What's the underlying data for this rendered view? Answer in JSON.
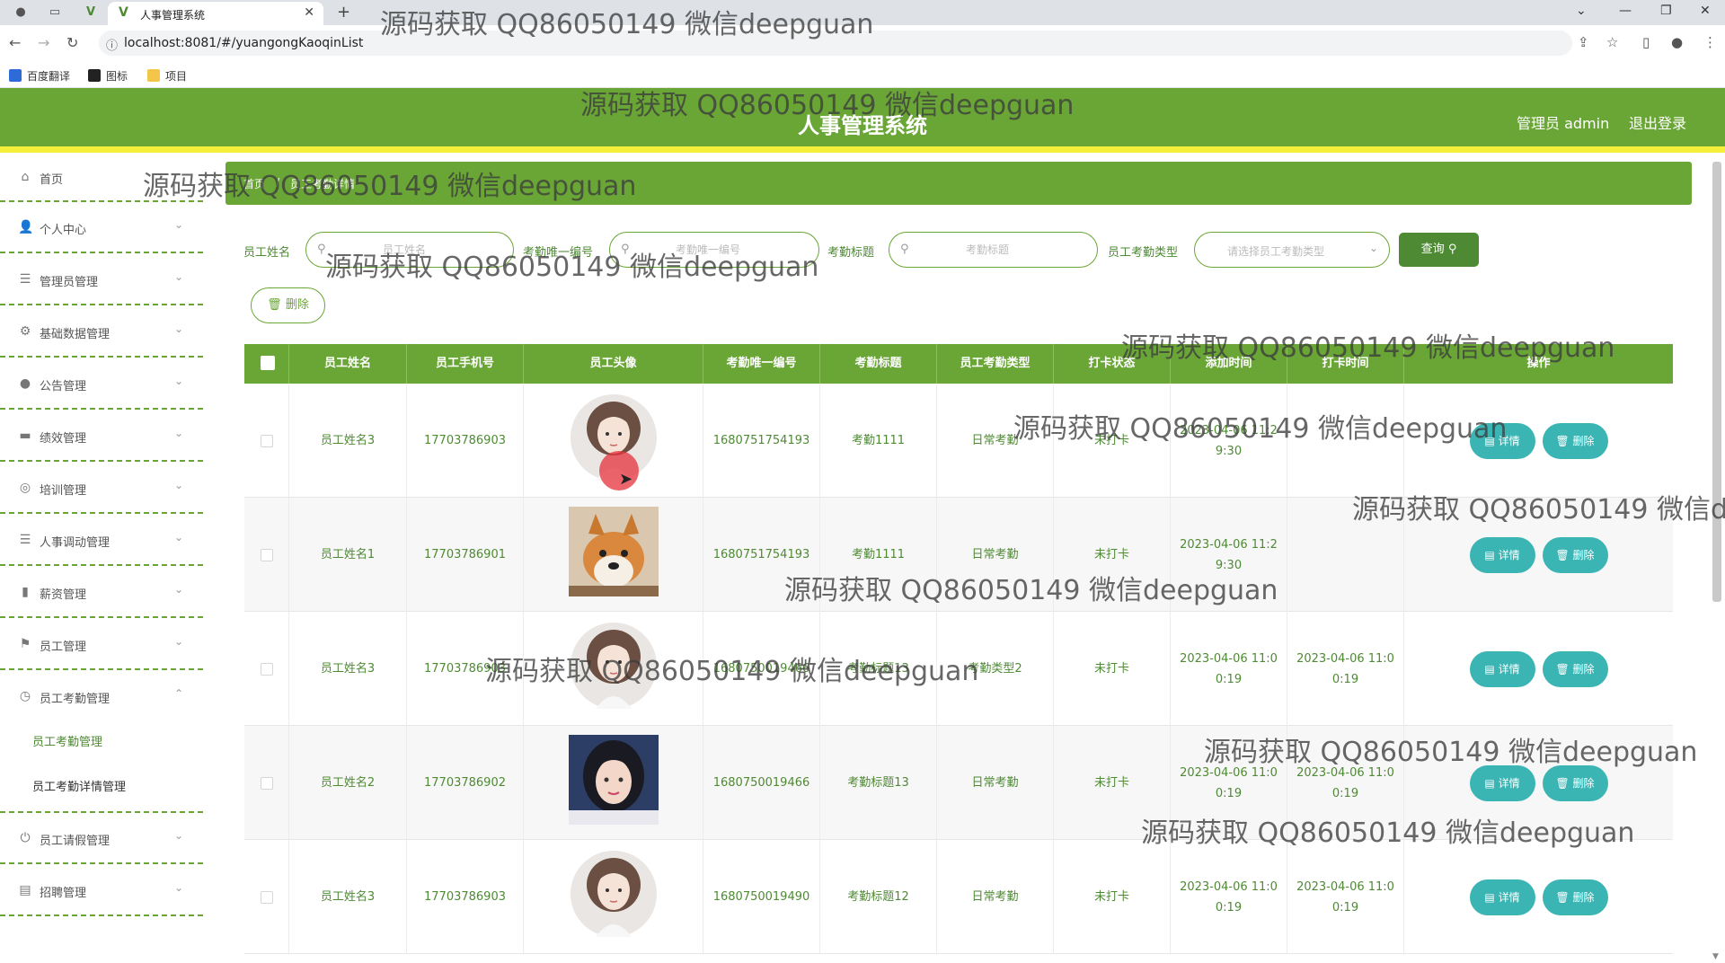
{
  "browser": {
    "tab_title": "人事管理系统",
    "url": "localhost:8081/#/yuangongKaoqinList",
    "bookmarks": [
      "百度翻译",
      "图标",
      "项目"
    ]
  },
  "header": {
    "title": "人事管理系统",
    "user": "管理员 admin",
    "logout": "退出登录"
  },
  "sidebar": {
    "items": [
      {
        "label": "首页",
        "icon": "home-icon"
      },
      {
        "label": "个人中心",
        "icon": "user-icon"
      },
      {
        "label": "管理员管理",
        "icon": "list-icon"
      },
      {
        "label": "基础数据管理",
        "icon": "settings-icon"
      },
      {
        "label": "公告管理",
        "icon": "pin-icon"
      },
      {
        "label": "绩效管理",
        "icon": "chat-icon"
      },
      {
        "label": "培训管理",
        "icon": "compass-icon"
      },
      {
        "label": "人事调动管理",
        "icon": "list-icon"
      },
      {
        "label": "薪资管理",
        "icon": "chart-icon"
      },
      {
        "label": "员工管理",
        "icon": "flag-icon"
      },
      {
        "label": "员工考勤管理",
        "icon": "clock-icon"
      },
      {
        "label": "员工请假管理",
        "icon": "power-icon"
      },
      {
        "label": "招聘管理",
        "icon": "card-icon"
      }
    ],
    "subitems": [
      "员工考勤管理",
      "员工考勤详情管理"
    ]
  },
  "breadcrumb": {
    "home": "首页",
    "current": "员工考勤详情"
  },
  "search": {
    "name_label": "员工姓名",
    "name_placeholder": "员工姓名",
    "code_label": "考勤唯一编号",
    "code_placeholder": "考勤唯一编号",
    "title_label": "考勤标题",
    "title_placeholder": "考勤标题",
    "type_label": "员工考勤类型",
    "type_placeholder": "请选择员工考勤类型",
    "query_button": "查询",
    "delete_button": "删除"
  },
  "table": {
    "headers": [
      "员工姓名",
      "员工手机号",
      "员工头像",
      "考勤唯一编号",
      "考勤标题",
      "员工考勤类型",
      "打卡状态",
      "添加时间",
      "打卡时间",
      "操作"
    ],
    "detail_label": "详情",
    "delete_label": "删除",
    "rows": [
      {
        "name": "员工姓名3",
        "phone": "17703786903",
        "avatar": "anime-girl",
        "code": "1680751754193",
        "title": "考勤1111",
        "type": "日常考勤",
        "status": "未打卡",
        "added": "2023-04-06 11:29:30",
        "clocked": ""
      },
      {
        "name": "员工姓名1",
        "phone": "17703786901",
        "avatar": "shiba-dog",
        "code": "1680751754193",
        "title": "考勤1111",
        "type": "日常考勤",
        "status": "未打卡",
        "added": "2023-04-06 11:29:30",
        "clocked": ""
      },
      {
        "name": "员工姓名3",
        "phone": "17703786903",
        "avatar": "anime-girl",
        "code": "1680750019466",
        "title": "考勤标题13",
        "type": "考勤类型2",
        "status": "未打卡",
        "added": "2023-04-06 11:00:19",
        "clocked": "2023-04-06 11:00:19"
      },
      {
        "name": "员工姓名2",
        "phone": "17703786902",
        "avatar": "photo-girl",
        "code": "1680750019466",
        "title": "考勤标题13",
        "type": "日常考勤",
        "status": "未打卡",
        "added": "2023-04-06 11:00:19",
        "clocked": "2023-04-06 11:00:19"
      },
      {
        "name": "员工姓名3",
        "phone": "17703786903",
        "avatar": "anime-girl",
        "code": "1680750019490",
        "title": "考勤标题12",
        "type": "日常考勤",
        "status": "未打卡",
        "added": "2023-04-06 11:00:19",
        "clocked": "2023-04-06 11:00:19"
      }
    ]
  },
  "watermark": "源码获取 QQ86050149 微信deepguan",
  "colors": {
    "primary": "#6aa636",
    "primary_dark": "#4e8a33",
    "accent_yellow": "#f5ef3a",
    "action_teal": "#3bb4b4"
  }
}
